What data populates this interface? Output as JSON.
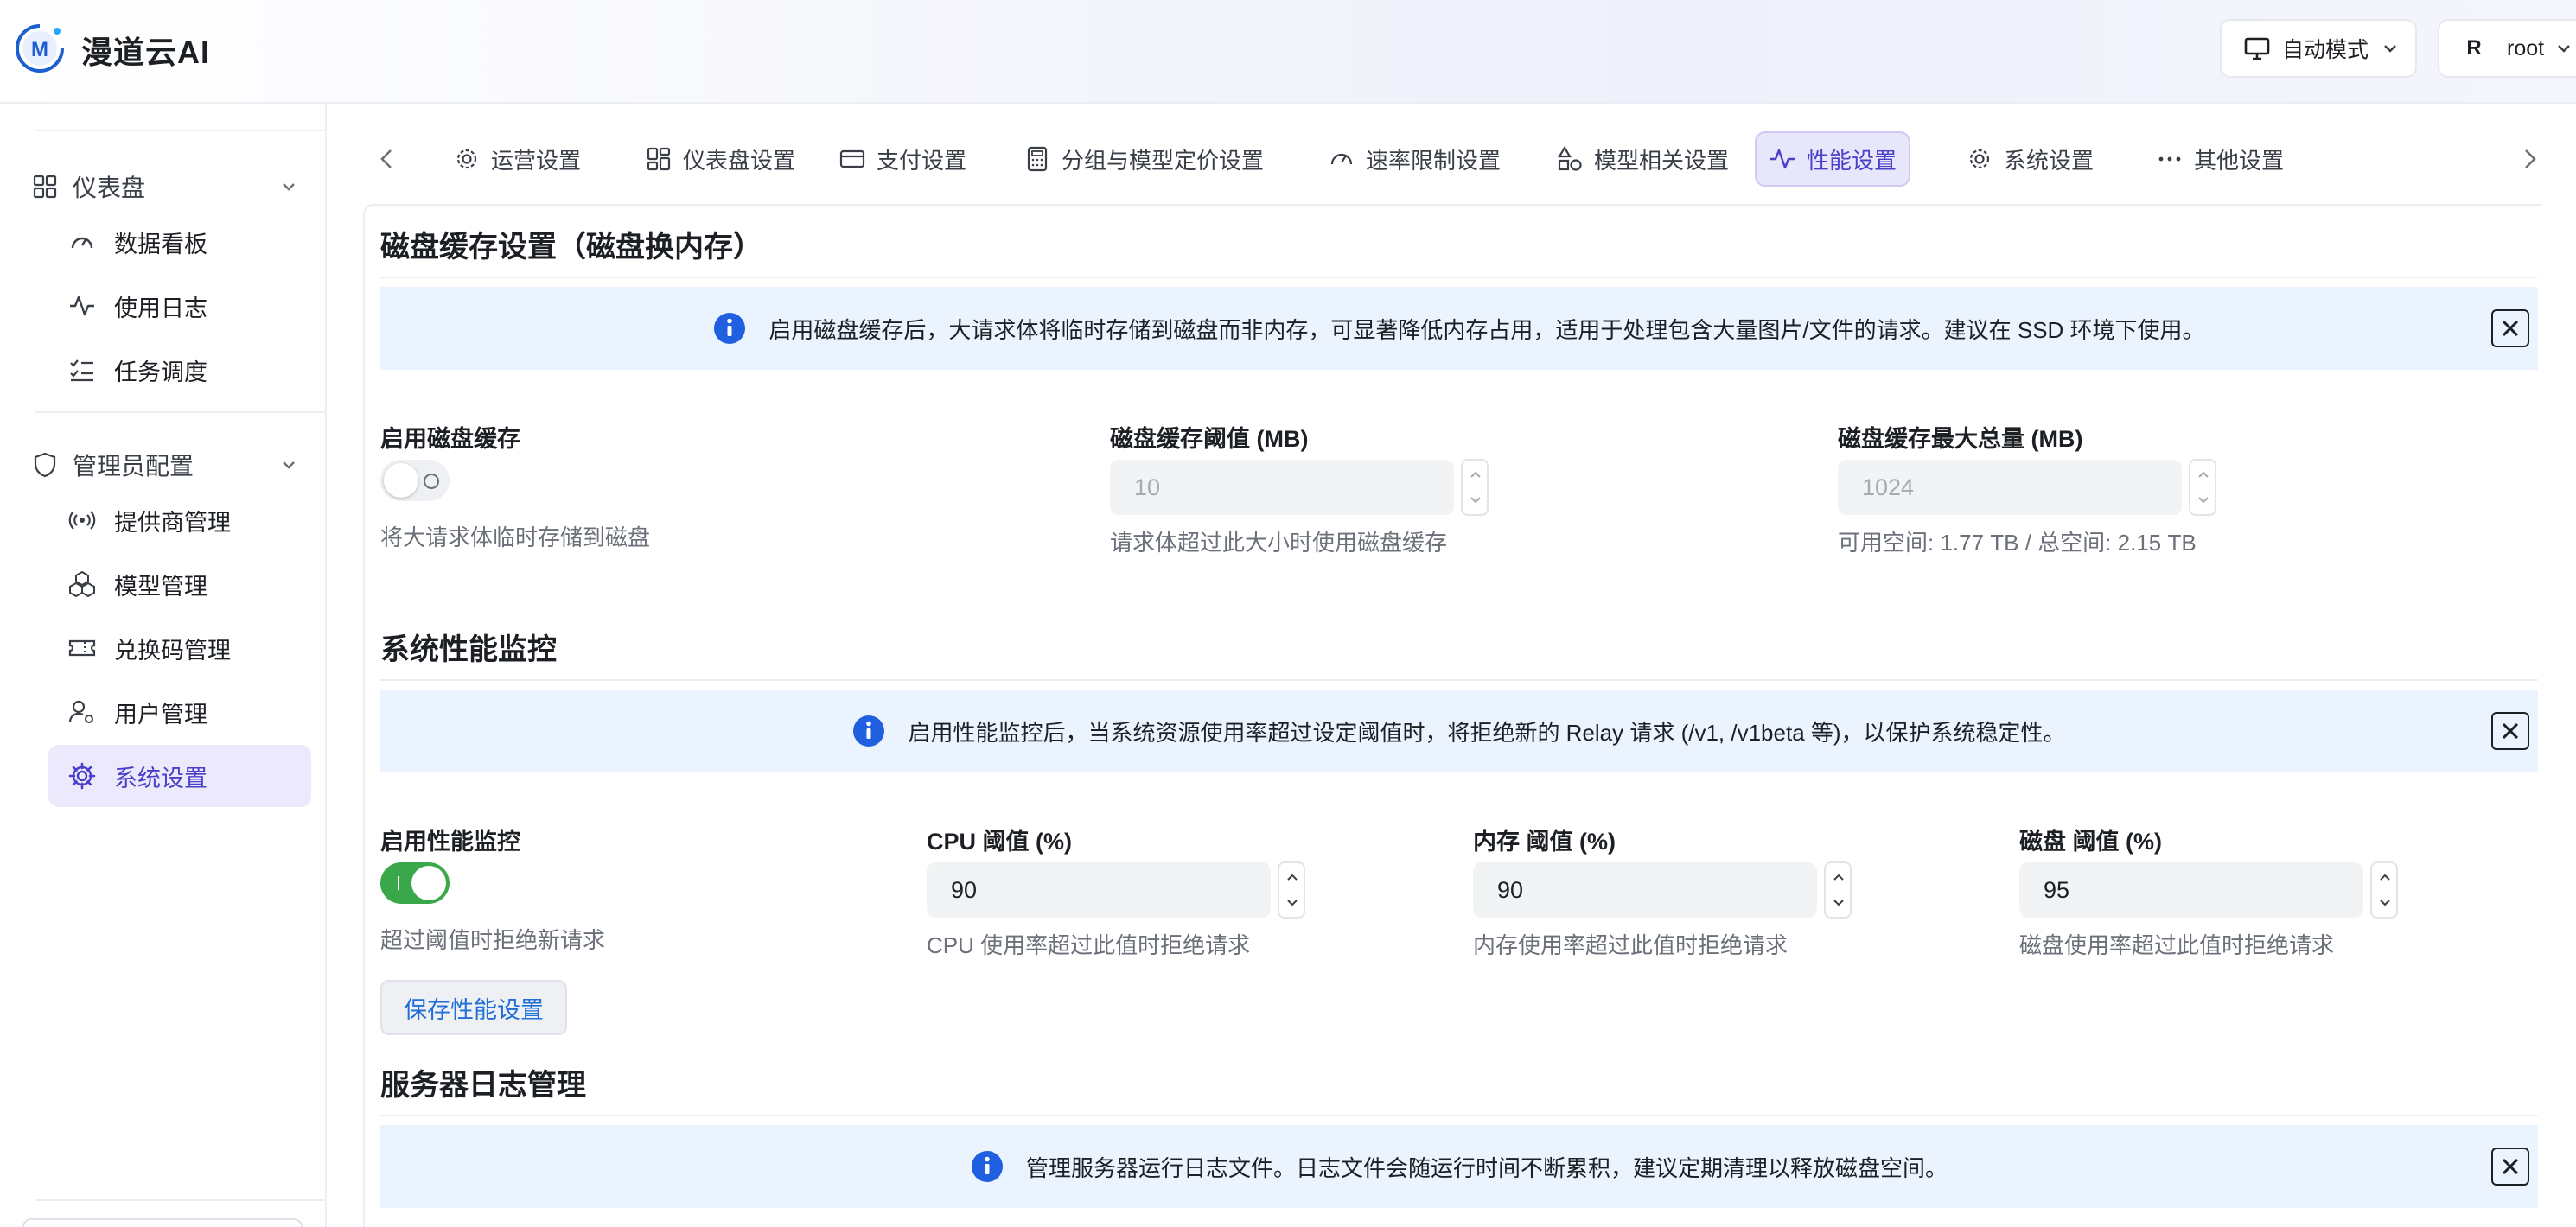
{
  "header": {
    "brand": "漫道云AI",
    "logo_letter": "M",
    "mode_label": "自动模式",
    "user_avatar": "R",
    "user_name": "root"
  },
  "sidebar": {
    "groups": [
      {
        "label": "仪表盘",
        "items": [
          {
            "label": "数据看板"
          },
          {
            "label": "使用日志"
          },
          {
            "label": "任务调度"
          }
        ]
      },
      {
        "label": "管理员配置",
        "items": [
          {
            "label": "提供商管理"
          },
          {
            "label": "模型管理"
          },
          {
            "label": "兑换码管理"
          },
          {
            "label": "用户管理"
          },
          {
            "label": "系统设置",
            "active": true
          }
        ]
      }
    ]
  },
  "tabs": [
    {
      "label": "运营设置"
    },
    {
      "label": "仪表盘设置"
    },
    {
      "label": "支付设置"
    },
    {
      "label": "分组与模型定价设置"
    },
    {
      "label": "速率限制设置"
    },
    {
      "label": "模型相关设置"
    },
    {
      "label": "性能设置",
      "active": true
    },
    {
      "label": "系统设置"
    },
    {
      "label": "其他设置"
    }
  ],
  "disk_cache": {
    "title": "磁盘缓存设置（磁盘换内存）",
    "banner": "启用磁盘缓存后，大请求体将临时存储到磁盘而非内存，可显著降低内存占用，适用于处理包含大量图片/文件的请求。建议在 SSD 环境下使用。",
    "enable_label": "启用磁盘缓存",
    "enable_help": "将大请求体临时存储到磁盘",
    "enabled": false,
    "threshold_label": "磁盘缓存阈值 (MB)",
    "threshold_value": "10",
    "threshold_help": "请求体超过此大小时使用磁盘缓存",
    "max_label": "磁盘缓存最大总量 (MB)",
    "max_value": "1024",
    "max_help": "可用空间: 1.77 TB / 总空间: 2.15 TB"
  },
  "perf_monitor": {
    "title": "系统性能监控",
    "banner": "启用性能监控后，当系统资源使用率超过设定阈值时，将拒绝新的 Relay 请求 (/v1, /v1beta 等)，以保护系统稳定性。",
    "enable_label": "启用性能监控",
    "enable_help": "超过阈值时拒绝新请求",
    "enabled": true,
    "cpu_label": "CPU 阈值 (%)",
    "cpu_value": "90",
    "cpu_help": "CPU 使用率超过此值时拒绝请求",
    "mem_label": "内存 阈值 (%)",
    "mem_value": "90",
    "mem_help": "内存使用率超过此值时拒绝请求",
    "disk_label": "磁盘 阈值 (%)",
    "disk_value": "95",
    "disk_help": "磁盘使用率超过此值时拒绝请求",
    "save_label": "保存性能设置"
  },
  "server_log": {
    "title": "服务器日志管理",
    "banner": "管理服务器运行日志文件。日志文件会随运行时间不断累积，建议定期清理以释放磁盘空间。"
  },
  "colors": {
    "accent": "#4a3fc8",
    "active_bg": "#ebe9fb",
    "banner_bg": "#eaf3fe",
    "info_icon": "#1f5fe0",
    "toggle_on": "#3aa84a",
    "link_blue": "#1f6fd6"
  }
}
